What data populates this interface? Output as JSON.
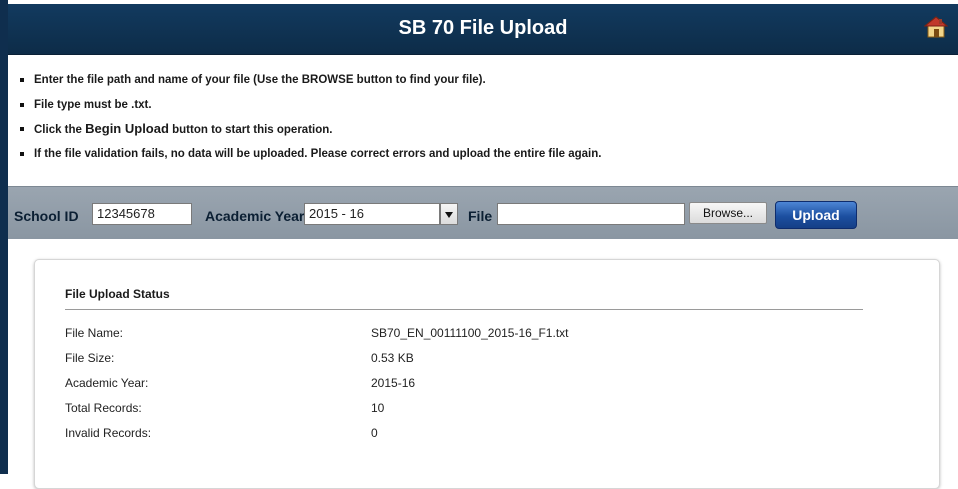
{
  "header": {
    "title": "SB 70 File Upload",
    "home_icon": "home-icon"
  },
  "instructions": [
    "Enter the file path and name of your file (Use the BROWSE button to find your file).",
    "File type must be .txt.",
    {
      "prefix": "Click the ",
      "emphasis": "Begin Upload",
      "suffix": " button to start this operation."
    },
    "If the file validation fails, no data will be uploaded. Please correct errors and upload the entire file again."
  ],
  "toolbar": {
    "school_id_label": "School ID",
    "school_id_value": "12345678",
    "academic_year_label": "Academic Year",
    "academic_year_value": "2015 - 16",
    "file_label": "File",
    "file_value": "",
    "browse_label": "Browse...",
    "upload_label": "Upload"
  },
  "status": {
    "title": "File Upload Status",
    "rows": [
      {
        "label": "File Name:",
        "value": "SB70_EN_00111100_2015-16_F1.txt"
      },
      {
        "label": "File Size:",
        "value": "0.53 KB"
      },
      {
        "label": "Academic Year:",
        "value": "2015-16"
      },
      {
        "label": "Total Records:",
        "value": "10"
      },
      {
        "label": "Invalid Records:",
        "value": "0"
      }
    ]
  },
  "colors": {
    "header_bg": "#123a5f",
    "toolbar_bg": "#9aa5b0",
    "upload_button": "#1c4fa0"
  }
}
